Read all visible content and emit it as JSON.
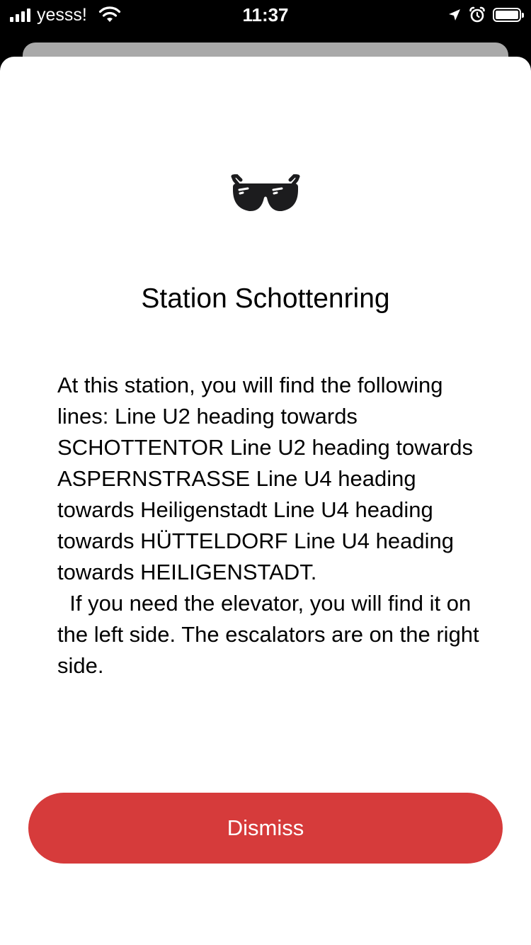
{
  "status_bar": {
    "carrier": "yesss!",
    "time": "11:37",
    "signal_bars": 4,
    "battery_level": 1.0,
    "icons": [
      "signal-icon",
      "wifi-icon",
      "location-arrow-icon",
      "alarm-icon",
      "battery-icon"
    ]
  },
  "sheet": {
    "icon": "sunglasses-icon",
    "title": "Station Schottenring",
    "body": "At this station, you will find the following lines: Line U2 heading towards SCHOTTENTOR Line U2 heading towards ASPERNSTRASSE Line U4 heading towards Heiligenstadt Line U4 heading towards HÜTTELDORF Line U4 heading towards HEILIGENSTADT.\n  If you need the elevator, you will find it on the left side. The escalators are on the right side.",
    "dismiss_label": "Dismiss"
  },
  "colors": {
    "accent": "#d63b3b",
    "background": "#ffffff",
    "status_bar": "#000000",
    "back_card": "#a9a9a9"
  }
}
